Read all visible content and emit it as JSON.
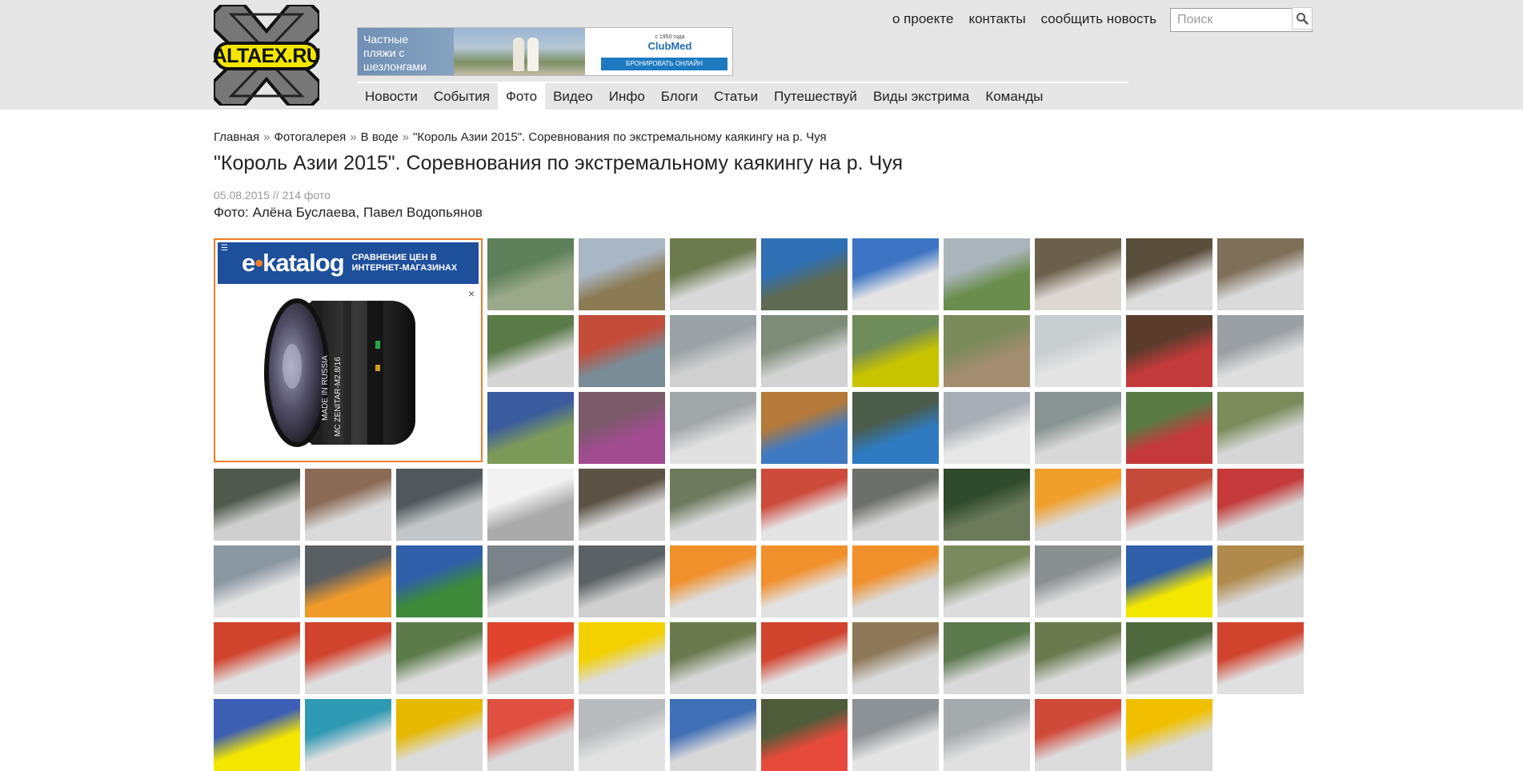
{
  "site": {
    "logo_text": "ALTAEX.RU"
  },
  "banner": {
    "text": "Частные пляжи с шезлонгами",
    "small": "с 1950 года",
    "brand": "ClubMed",
    "button": "БРОНИРОВАТЬ ОНЛАЙН"
  },
  "toplinks": {
    "about": "о проекте",
    "contacts": "контакты",
    "report": "сообщить новость"
  },
  "search": {
    "placeholder": "Поиск"
  },
  "nav": {
    "items": [
      "Новости",
      "События",
      "Фото",
      "Видео",
      "Инфо",
      "Блоги",
      "Статьи",
      "Путешествуй",
      "Виды экстрима",
      "Команды"
    ],
    "active_index": 2
  },
  "breadcrumb": {
    "items": [
      "Главная",
      "Фотогалерея",
      "В воде",
      "\"Король Азии 2015\". Соревнования по экстремальному каякингу на р. Чуя"
    ],
    "separator": "»"
  },
  "page": {
    "title": "\"Король Азии 2015\". Соревнования по экстремальному каякингу на р. Чуя",
    "meta": "05.08.2015 // 214 фото",
    "authors": "Фото: Алёна Буслаева, Павел Водопьянов"
  },
  "ad": {
    "brand_e": "e",
    "brand_dot": "•",
    "brand_rest": "katalog",
    "subtitle": "СРАВНЕНИЕ ЦЕН В ИНТЕРНЕТ-МАГАЗИНАХ",
    "lens_line1": "MADE IN RUSSIA",
    "lens_line2": "MC ZENITAR-M2.8/16",
    "close": "×",
    "menu": "☰"
  },
  "colors": {
    "accent_orange": "#f07d28",
    "ad_blue": "#1d4f9b",
    "logo_yellow": "#f3e600",
    "topband": "#e6e6e6"
  },
  "gallery": {
    "thumbs": [
      [
        "#5d7f5a",
        "#9aa98a"
      ],
      [
        "#a9b6c4",
        "#8b7b54"
      ],
      [
        "#6c7a4e",
        "#d9d9d9"
      ],
      [
        "#2f6fb4",
        "#5e6b52"
      ],
      [
        "#3d75c4",
        "#e4e4e4"
      ],
      [
        "#aab4bb",
        "#6a8d4d"
      ],
      [
        "#6b604c",
        "#ddd9d2"
      ],
      [
        "#5a4e3d",
        "#dcdcdc"
      ],
      [
        "#7d6f58",
        "#dadada"
      ],
      [
        "#5a7a48",
        "#d5d5d5"
      ],
      [
        "#c34d3a",
        "#7a8c96"
      ],
      [
        "#9aa2a6",
        "#d0d0d0"
      ],
      [
        "#7d8c78",
        "#d3d3d3"
      ],
      [
        "#6f8d5a",
        "#c9c400"
      ],
      [
        "#7b8a5a",
        "#a28d70"
      ],
      [
        "#c8cdd0",
        "#e4e4e4"
      ],
      [
        "#5b3c2c",
        "#c43b3b"
      ],
      [
        "#9a9fa4",
        "#dedede"
      ],
      [
        "#3a5c9e",
        "#7c9a5a"
      ],
      [
        "#7b5a6a",
        "#a04c8e"
      ],
      [
        "#a1a6a8",
        "#e0e0e0"
      ],
      [
        "#b57a3a",
        "#3f7ac0"
      ],
      [
        "#4b5c4a",
        "#2f7ac0"
      ],
      [
        "#a7aeb4",
        "#e7e7e7"
      ],
      [
        "#889491",
        "#d9d9d9"
      ],
      [
        "#5a7a45",
        "#c43a3a"
      ],
      [
        "#7a8c5a",
        "#d6d6d6"
      ],
      [
        "#4f5a4c",
        "#cfcfcf"
      ],
      [
        "#8b6a55",
        "#dadada"
      ],
      [
        "#50585c",
        "#c2c6c8"
      ],
      [
        "#f2f2f2",
        "#aaaaaa"
      ],
      [
        "#5b5245",
        "#d7d7d7"
      ],
      [
        "#6e7a5e",
        "#d9d9d9"
      ],
      [
        "#cc4a3a",
        "#e4e4e4"
      ],
      [
        "#6d6f6a",
        "#d6d6d6"
      ],
      [
        "#2f4a2c",
        "#6a7a5a"
      ],
      [
        "#f0a02a",
        "#dadada"
      ],
      [
        "#c44a3a",
        "#e0e0e0"
      ],
      [
        "#c43a3a",
        "#d8d8d8"
      ],
      [
        "#8a96a0",
        "#e3e3e3"
      ],
      [
        "#5a5f63",
        "#f09a2a"
      ],
      [
        "#2f5fa8",
        "#3c8a3a"
      ],
      [
        "#7a8387",
        "#dcdcdc"
      ],
      [
        "#5b6164",
        "#cfcfcf"
      ],
      [
        "#f0902a",
        "#dedede"
      ],
      [
        "#f0902a",
        "#e2e2e2"
      ],
      [
        "#f0902a",
        "#dcdcdc"
      ],
      [
        "#7a8a5e",
        "#dcdcdc"
      ],
      [
        "#8a8f92",
        "#dddddd"
      ],
      [
        "#2f5fa8",
        "#f3e600"
      ],
      [
        "#b08a4a",
        "#d9d9d9"
      ],
      [
        "#d0442e",
        "#e0e0e0"
      ],
      [
        "#d0442e",
        "#dedede"
      ],
      [
        "#5c7a4a",
        "#dcdcdc"
      ],
      [
        "#e0442e",
        "#dadada"
      ],
      [
        "#f3d000",
        "#dcdcdc"
      ],
      [
        "#6b7a4e",
        "#d6d6d6"
      ],
      [
        "#d0442e",
        "#e2e2e2"
      ],
      [
        "#8d7858",
        "#dadada"
      ],
      [
        "#5d7a4e",
        "#d9d9d9"
      ],
      [
        "#6a7a4e",
        "#dadada"
      ],
      [
        "#4e6a3e",
        "#dcdcdc"
      ],
      [
        "#d0442e",
        "#e0e0e0"
      ],
      [
        "#3c5fb4",
        "#f3e600"
      ],
      [
        "#2f9ab4",
        "#dedede"
      ],
      [
        "#e6b800",
        "#dcdcdc"
      ],
      [
        "#e05040",
        "#dadada"
      ],
      [
        "#b8bcbe",
        "#e2e2e2"
      ],
      [
        "#3f6fb4",
        "#d8d8d8"
      ],
      [
        "#4e5c3a",
        "#e64a3a"
      ],
      [
        "#8d9296",
        "#e4e4e4"
      ],
      [
        "#a5aaad",
        "#e0e0e0"
      ],
      [
        "#d04a3a",
        "#dcdcdc"
      ],
      [
        "#f0c000",
        "#dadada"
      ]
    ]
  }
}
